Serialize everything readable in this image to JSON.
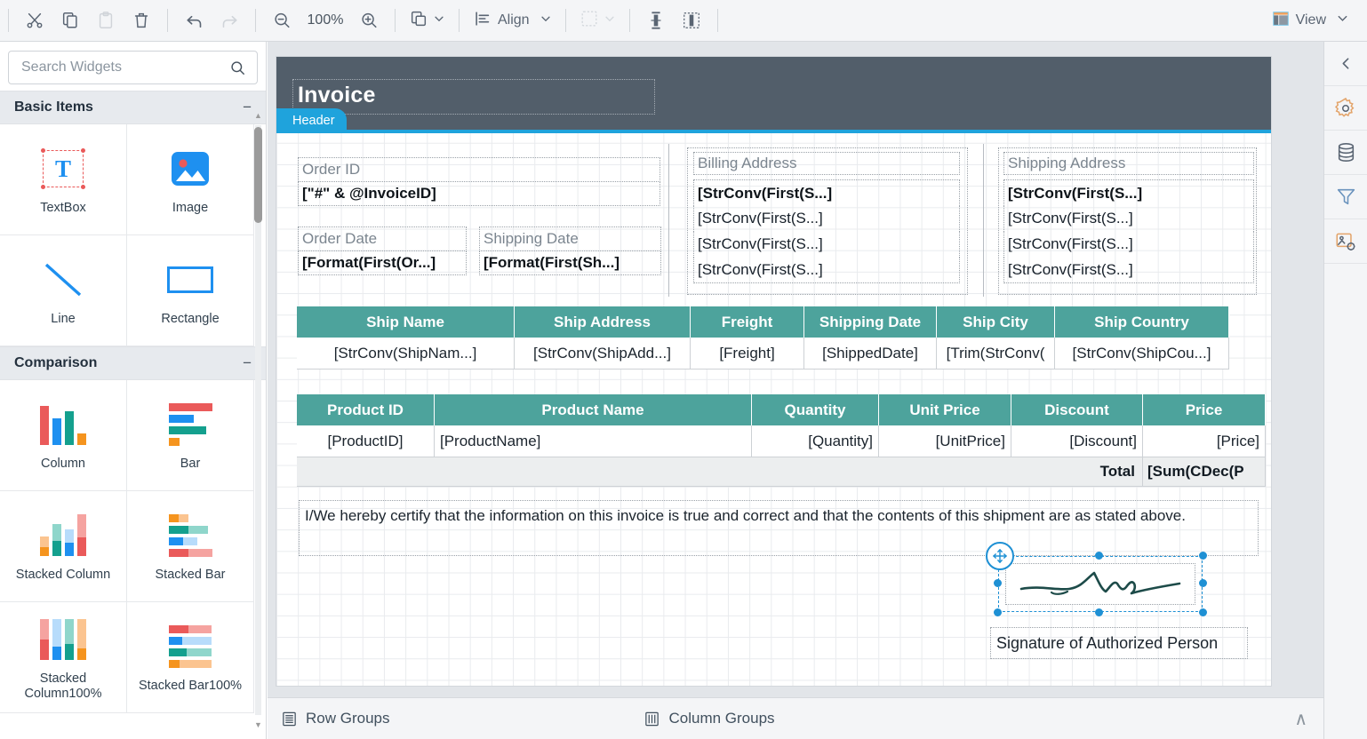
{
  "toolbar": {
    "cut": "Cut",
    "copy": "Copy",
    "paste": "Paste",
    "delete": "Delete",
    "undo": "Undo",
    "redo": "Redo",
    "zoom_out": "Zoom Out",
    "zoom_level": "100%",
    "zoom_in": "Zoom In",
    "arrange": "Arrange",
    "align": "Align",
    "group": "Group",
    "size_to_fit_width": "Make Same Width",
    "size_to_fit_height": "Make Same Height",
    "view": "View",
    "caret": "∨"
  },
  "widgets_panel": {
    "search_placeholder": "Search Widgets",
    "search_value": "",
    "collapse_glyph": "−",
    "categories": [
      {
        "title": "Basic Items",
        "items": [
          {
            "label": "TextBox",
            "icon": "textbox-icon"
          },
          {
            "label": "Image",
            "icon": "image-icon"
          },
          {
            "label": "Line",
            "icon": "line-icon"
          },
          {
            "label": "Rectangle",
            "icon": "rectangle-icon"
          }
        ]
      },
      {
        "title": "Comparison",
        "items": [
          {
            "label": "Column",
            "icon": "column-chart-icon"
          },
          {
            "label": "Bar",
            "icon": "bar-chart-icon"
          },
          {
            "label": "Stacked Column",
            "icon": "stacked-column-chart-icon"
          },
          {
            "label": "Stacked Bar",
            "icon": "stacked-bar-chart-icon"
          },
          {
            "label": "Stacked Column100%",
            "icon": "stacked-column-100-chart-icon"
          },
          {
            "label": "Stacked Bar100%",
            "icon": "stacked-bar-100-chart-icon"
          }
        ]
      }
    ]
  },
  "report": {
    "header": {
      "title": "Invoice",
      "band_label": "Header"
    },
    "fields": {
      "order_id_label": "Order ID",
      "order_id_value": "[\"#\" & @InvoiceID]",
      "order_date_label": "Order Date",
      "order_date_value": "[Format(First(Or...]",
      "shipping_date_label": "Shipping Date",
      "shipping_date_value": "[Format(First(Sh...]",
      "billing_address_label": "Billing Address",
      "billing_address_lines": [
        "[StrConv(First(S...]",
        "[StrConv(First(S...]",
        "[StrConv(First(S...]",
        "[StrConv(First(S...]"
      ],
      "shipping_address_label": "Shipping Address",
      "shipping_address_lines": [
        "[StrConv(First(S...]",
        "[StrConv(First(S...]",
        "[StrConv(First(S...]",
        "[StrConv(First(S...]"
      ]
    },
    "ship_table": {
      "headers": [
        "Ship Name",
        "Ship Address",
        "Freight",
        "Shipping Date",
        "Ship City",
        "Ship Country"
      ],
      "row": [
        "[StrConv(ShipNam...]",
        "[StrConv(ShipAdd...]",
        "[Freight]",
        "[ShippedDate]",
        "[Trim(StrConv(",
        "[StrConv(ShipCou...]"
      ]
    },
    "product_table": {
      "headers": [
        "Product ID",
        "Product Name",
        "Quantity",
        "Unit Price",
        "Discount",
        "Price"
      ],
      "row": [
        "[ProductID]",
        "[ProductName]",
        "[Quantity]",
        "[UnitPrice]",
        "[Discount]",
        "[Price]"
      ],
      "total_label": "Total",
      "total_value": "[Sum(CDec(P"
    },
    "certify_text": "I/We hereby certify that the information on this invoice is true and correct and that the contents of this shipment are as stated above.",
    "signature_caption": "Signature of Authorized Person",
    "signature_alt": "signature"
  },
  "right_rail": {
    "items": [
      {
        "name": "collapse-panel",
        "icon": "chevron-left-icon"
      },
      {
        "name": "properties",
        "icon": "gear-icon"
      },
      {
        "name": "data-sources",
        "icon": "database-icon"
      },
      {
        "name": "filters",
        "icon": "filter-icon"
      },
      {
        "name": "image-settings",
        "icon": "image-settings-icon"
      }
    ]
  },
  "bottom_bar": {
    "row_groups": "Row Groups",
    "column_groups": "Column Groups",
    "expand_glyph": "∧"
  },
  "colors": {
    "accent_blue": "#1fa3dc",
    "header_band": "#525e6a",
    "table_header_teal": "#4da39c",
    "chart_red": "#ea5a5a",
    "chart_blue": "#1e90f0",
    "chart_teal": "#14a08e",
    "chart_orange": "#f5941e",
    "selection_blue": "#1e90d4"
  }
}
